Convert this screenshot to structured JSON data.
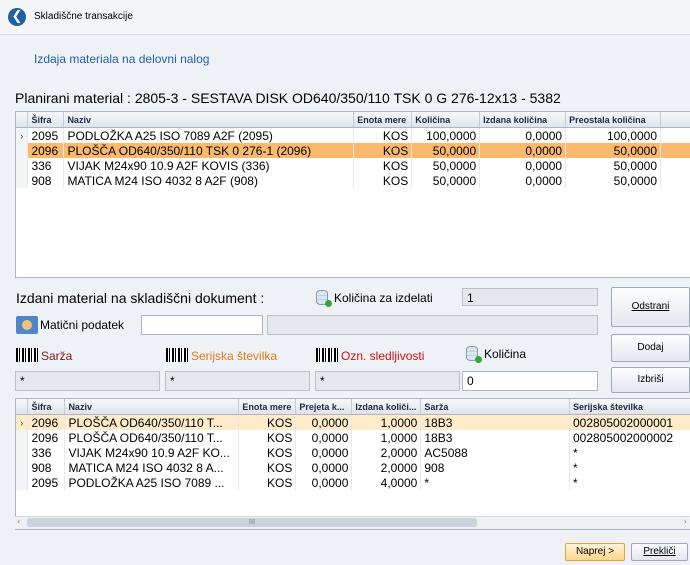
{
  "window": {
    "title": "Skladiščne transakcije"
  },
  "subtitle": "Izdaja materiala na delovni nalog",
  "planned_header": "Planirani material : 2805-3 - SESTAVA DISK OD640/350/110 TSK 0 G 276-12x13 - 5382",
  "planned_grid": {
    "columns": [
      "Šifra",
      "Naziv",
      "Enota mere",
      "Količina",
      "Izdana količina",
      "Preostala količina"
    ],
    "rows": [
      {
        "indicator": "›",
        "code": "2095",
        "name": "PODLOŽKA A25 ISO 7089 A2F (2095)",
        "unit": "KOS",
        "qty": "100,0000",
        "issued": "0,0000",
        "remaining": "100,0000"
      },
      {
        "indicator": "",
        "code": "2096",
        "name": "PLOŠČA OD640/350/110 TSK 0 276-1 (2096)",
        "unit": "KOS",
        "qty": "50,0000",
        "issued": "0,0000",
        "remaining": "50,0000"
      },
      {
        "indicator": "",
        "code": "336",
        "name": "VIJAK M24x90 10.9 A2F KOVIS (336)",
        "unit": "KOS",
        "qty": "50,0000",
        "issued": "0,0000",
        "remaining": "50,0000"
      },
      {
        "indicator": "",
        "code": "908",
        "name": "MATICA M24 ISO 4032 8 A2F (908)",
        "unit": "KOS",
        "qty": "50,0000",
        "issued": "0,0000",
        "remaining": "50,0000"
      }
    ]
  },
  "issued_section": {
    "label": "Izdani material na skladiščni dokument :",
    "qty_for_product_label": "Količina za izdelati",
    "qty_for_product_value": "1",
    "master_data_label": "Matični podatek",
    "master_data_value": "",
    "master_data_desc": "",
    "batch_label": "Sarža",
    "serial_label": "Serijska številka",
    "tracking_label": "Ozn. sledljivosti",
    "quantity_label": "Količina",
    "batch_value": "*",
    "serial_value": "*",
    "tracking_value": "*",
    "quantity_value": "0",
    "colors": {
      "batch": "#7a1b1b",
      "serial": "#e07a1a",
      "tracking": "#d01010"
    }
  },
  "buttons": {
    "remove": "Odstrani",
    "add": "Dodaj",
    "delete": "Izbriši",
    "next": "Naprej >",
    "cancel": "Prekliči"
  },
  "issued_grid": {
    "columns": [
      "Šifra",
      "Naziv",
      "Enota mere",
      "Prejeta k...",
      "Izdana količi...",
      "Sarža",
      "Serijska številka"
    ],
    "rows": [
      {
        "indicator": "›",
        "code": "2096",
        "name": "PLOŠČA OD640/350/110 T...",
        "unit": "KOS",
        "received": "0,0000",
        "issued": "1,0000",
        "batch": "18B3",
        "serial": "002805002000001"
      },
      {
        "indicator": "",
        "code": "2096",
        "name": "PLOŠČA OD640/350/110 T...",
        "unit": "KOS",
        "received": "0,0000",
        "issued": "1,0000",
        "batch": "18B3",
        "serial": "002805002000002"
      },
      {
        "indicator": "",
        "code": "336",
        "name": "VIJAK M24x90 10.9 A2F KO...",
        "unit": "KOS",
        "received": "0,0000",
        "issued": "2,0000",
        "batch": "AC5088",
        "serial": "*"
      },
      {
        "indicator": "",
        "code": "908",
        "name": "MATICA M24 ISO 4032 8 A...",
        "unit": "KOS",
        "received": "0,0000",
        "issued": "2,0000",
        "batch": "908",
        "serial": "*"
      },
      {
        "indicator": "",
        "code": "2095",
        "name": "PODLOŽKA A25 ISO 7089 ...",
        "unit": "KOS",
        "received": "0,0000",
        "issued": "4,0000",
        "batch": "*",
        "serial": "*"
      }
    ]
  },
  "scroll": {
    "left_arrow": "‹",
    "thumb": "III",
    "right_arrow": "›"
  }
}
